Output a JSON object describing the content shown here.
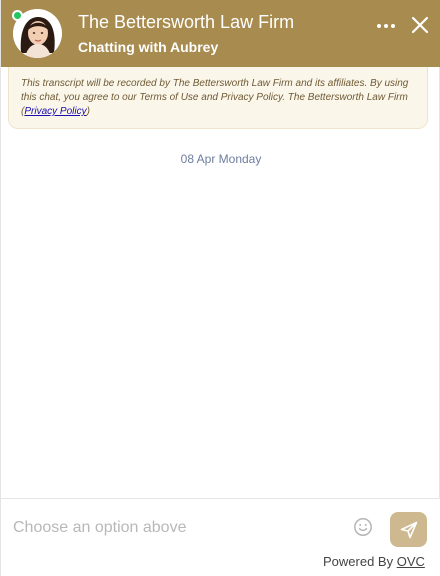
{
  "header": {
    "title": "The Bettersworth Law Firm",
    "subtitle": "Chatting with Aubrey",
    "status": "online",
    "background_color": "#a78b4f"
  },
  "notice": {
    "text": "This transcript will be recorded by The Bettersworth Law Firm and its affiliates. By using this chat, you agree to our Terms of Use and Privacy Policy. The Bettersworth Law Firm (",
    "link_label": "Privacy Policy",
    "suffix": ")"
  },
  "conversation": {
    "date_label": "08 Apr Monday"
  },
  "composer": {
    "placeholder": "Choose an option above",
    "send_button_color": "#cdb890"
  },
  "footer": {
    "powered_by": "Powered By ",
    "brand": "OVC"
  },
  "icons": [
    "agent-avatar",
    "online-status-dot",
    "more-options-icon",
    "close-icon",
    "emoji-icon",
    "send-icon"
  ]
}
